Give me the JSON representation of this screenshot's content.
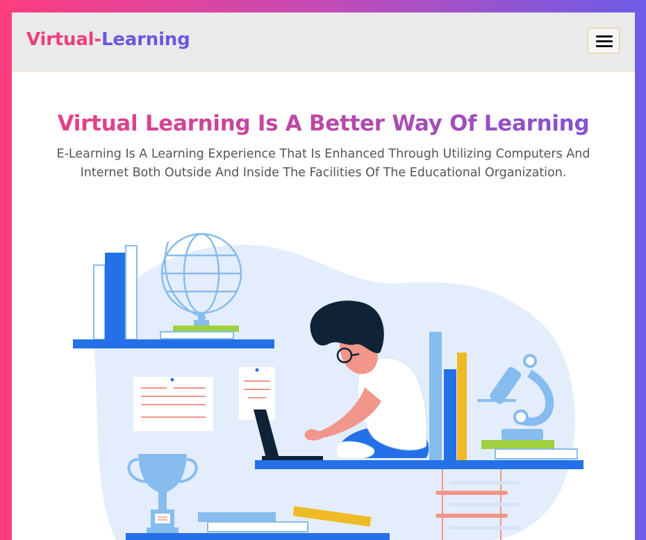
{
  "navbar": {
    "brand_part1": "Virtual-",
    "brand_part2": "Learning",
    "menu_icon": "hamburger-menu-icon"
  },
  "hero": {
    "title": "Virtual Learning Is A Better Way Of Learning",
    "description": "E-Learning Is A Learning Experience That Is Enhanced Through Utilizing Computers And Internet Both Outside And Inside The Facilities Of The Educational Organization."
  },
  "illustration": {
    "name": "student-with-laptop-illustration",
    "colors": {
      "blob": "#e4edfb",
      "blue": "#2470e8",
      "light_blue": "#86bcee",
      "yellow": "#f0ba24",
      "green": "#9fd13f",
      "salmon": "#f2958a",
      "hair": "#0f2236"
    }
  },
  "colors": {
    "gradient_start": "#ff3d7f",
    "gradient_end": "#6c5ce7",
    "navbar_bg": "#eaeaea"
  }
}
